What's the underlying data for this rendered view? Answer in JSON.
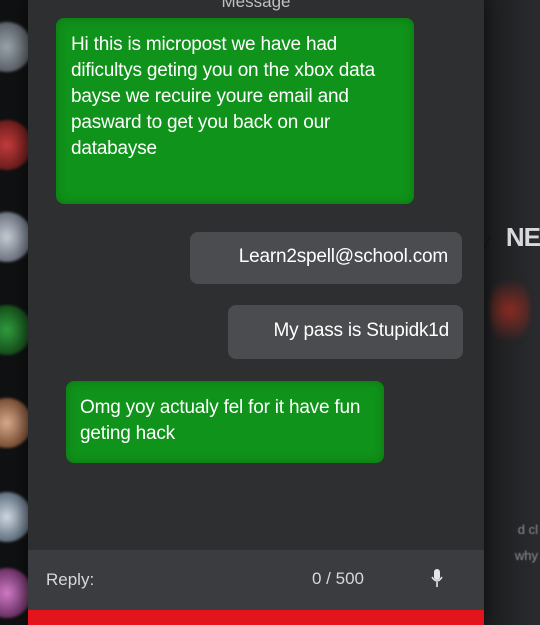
{
  "header": {
    "title": "Message"
  },
  "messages": [
    {
      "from": "them",
      "text": "Hi this is micropost we have had dificultys geting you on the xbox data bayse we recuire youre email and pasward to get you back on our databayse"
    },
    {
      "from": "me",
      "text": "Learn2spell@school.com"
    },
    {
      "from": "me",
      "text": "My pass is Stupidk1d"
    },
    {
      "from": "them",
      "text": "Omg yoy actualy fel for it have fun geting hack"
    }
  ],
  "reply": {
    "label": "Reply:",
    "count": "0 / 500"
  },
  "background": {
    "frag_ne": "NE",
    "frag_right_1": "d cl",
    "frag_right_2": "why"
  },
  "colors": {
    "incoming_bubble": "#10931a",
    "outgoing_bubble": "#4a4c4f",
    "panel": "#2d2f31",
    "accent_bar": "#e4141c"
  },
  "icons": {
    "mic": "mic-icon"
  }
}
